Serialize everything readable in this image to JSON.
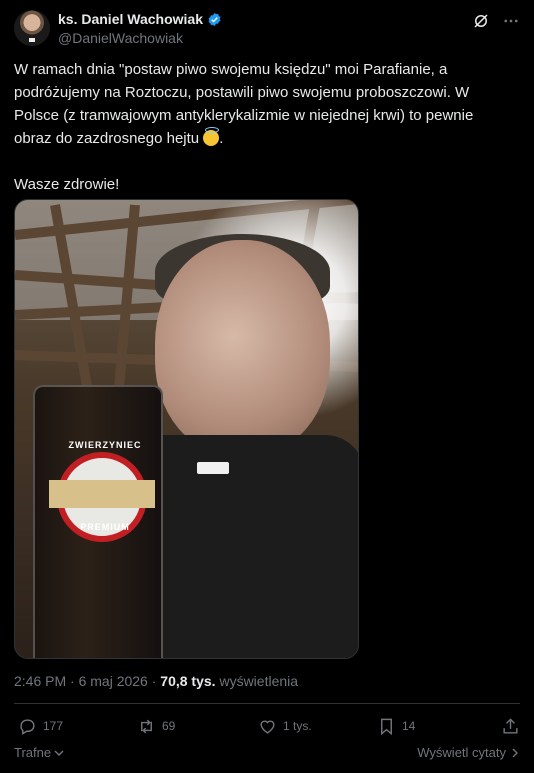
{
  "author": {
    "name": "ks. Daniel Wachowiak",
    "handle": "@DanielWachowiak"
  },
  "header_icons": [
    "grok-icon",
    "more-icon"
  ],
  "tweet": {
    "text": "W ramach dnia \"postaw piwo swojemu księdzu\" moi Parafianie, a podróżujemy na Roztoczu, postawili piwo swojemu proboszczowi. W Polsce (z tramwajowym antyklerykalizmie w niejednej krwi) to pewnie obraz do zazdrosnego hejtu ",
    "emoji": "smiling-face-with-halo",
    "text2": "Wasze zdrowie!"
  },
  "photo": {
    "logo_top": "ZWIERZYNIEC",
    "logo_bottom": "PREMIUM"
  },
  "meta": {
    "time": "2:46 PM · 6 maj 2026 · ",
    "views": "70,8 tys.",
    "views_label": " wyświetlenia"
  },
  "actions": {
    "replies": "177",
    "reposts": "69",
    "likes": "1 tys.",
    "bookmarks": "14"
  },
  "bottom": {
    "sort_label": "Trafne",
    "quotes_label": "Wyświetl cytaty"
  },
  "colors": {
    "verified": "#1d9bf0",
    "text": "#e7e9ea",
    "secondary": "#71767b",
    "background": "#000000"
  }
}
